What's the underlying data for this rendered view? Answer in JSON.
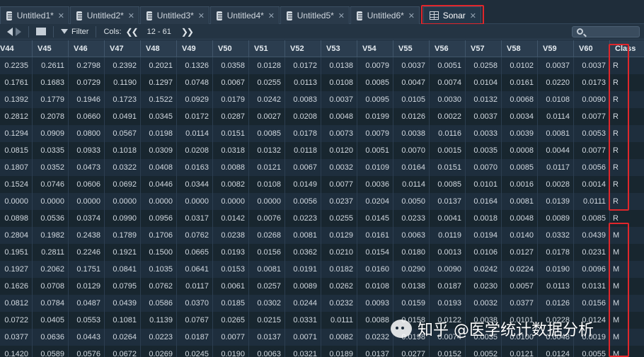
{
  "tabs": [
    {
      "label": "Untitled1*"
    },
    {
      "label": "Untitled2*"
    },
    {
      "label": "Untitled3*"
    },
    {
      "label": "Untitled4*"
    },
    {
      "label": "Untitled5*"
    },
    {
      "label": "Untitled6*"
    },
    {
      "label": "Sonar",
      "active": true
    }
  ],
  "toolbar": {
    "filter_label": "Filter",
    "cols_label": "Cols:",
    "cols_range": "12 - 61"
  },
  "table": {
    "columns": [
      "V44",
      "V45",
      "V46",
      "V47",
      "V48",
      "V49",
      "V50",
      "V51",
      "V52",
      "V53",
      "V54",
      "V55",
      "V56",
      "V57",
      "V58",
      "V59",
      "V60",
      "Class"
    ],
    "rows": [
      [
        "0.2235",
        "0.2611",
        "0.2798",
        "0.2392",
        "0.2021",
        "0.1326",
        "0.0358",
        "0.0128",
        "0.0172",
        "0.0138",
        "0.0079",
        "0.0037",
        "0.0051",
        "0.0258",
        "0.0102",
        "0.0037",
        "0.0037",
        "R"
      ],
      [
        "0.1761",
        "0.1683",
        "0.0729",
        "0.1190",
        "0.1297",
        "0.0748",
        "0.0067",
        "0.0255",
        "0.0113",
        "0.0108",
        "0.0085",
        "0.0047",
        "0.0074",
        "0.0104",
        "0.0161",
        "0.0220",
        "0.0173",
        "R"
      ],
      [
        "0.1392",
        "0.1779",
        "0.1946",
        "0.1723",
        "0.1522",
        "0.0929",
        "0.0179",
        "0.0242",
        "0.0083",
        "0.0037",
        "0.0095",
        "0.0105",
        "0.0030",
        "0.0132",
        "0.0068",
        "0.0108",
        "0.0090",
        "R"
      ],
      [
        "0.2812",
        "0.2078",
        "0.0660",
        "0.0491",
        "0.0345",
        "0.0172",
        "0.0287",
        "0.0027",
        "0.0208",
        "0.0048",
        "0.0199",
        "0.0126",
        "0.0022",
        "0.0037",
        "0.0034",
        "0.0114",
        "0.0077",
        "R"
      ],
      [
        "0.1294",
        "0.0909",
        "0.0800",
        "0.0567",
        "0.0198",
        "0.0114",
        "0.0151",
        "0.0085",
        "0.0178",
        "0.0073",
        "0.0079",
        "0.0038",
        "0.0116",
        "0.0033",
        "0.0039",
        "0.0081",
        "0.0053",
        "R"
      ],
      [
        "0.0815",
        "0.0335",
        "0.0933",
        "0.1018",
        "0.0309",
        "0.0208",
        "0.0318",
        "0.0132",
        "0.0118",
        "0.0120",
        "0.0051",
        "0.0070",
        "0.0015",
        "0.0035",
        "0.0008",
        "0.0044",
        "0.0077",
        "R"
      ],
      [
        "0.1807",
        "0.0352",
        "0.0473",
        "0.0322",
        "0.0408",
        "0.0163",
        "0.0088",
        "0.0121",
        "0.0067",
        "0.0032",
        "0.0109",
        "0.0164",
        "0.0151",
        "0.0070",
        "0.0085",
        "0.0117",
        "0.0056",
        "R"
      ],
      [
        "0.1524",
        "0.0746",
        "0.0606",
        "0.0692",
        "0.0446",
        "0.0344",
        "0.0082",
        "0.0108",
        "0.0149",
        "0.0077",
        "0.0036",
        "0.0114",
        "0.0085",
        "0.0101",
        "0.0016",
        "0.0028",
        "0.0014",
        "R"
      ],
      [
        "0.0000",
        "0.0000",
        "0.0000",
        "0.0000",
        "0.0000",
        "0.0000",
        "0.0000",
        "0.0000",
        "0.0056",
        "0.0237",
        "0.0204",
        "0.0050",
        "0.0137",
        "0.0164",
        "0.0081",
        "0.0139",
        "0.0111",
        "R"
      ],
      [
        "0.0898",
        "0.0536",
        "0.0374",
        "0.0990",
        "0.0956",
        "0.0317",
        "0.0142",
        "0.0076",
        "0.0223",
        "0.0255",
        "0.0145",
        "0.0233",
        "0.0041",
        "0.0018",
        "0.0048",
        "0.0089",
        "0.0085",
        "R"
      ],
      [
        "0.2804",
        "0.1982",
        "0.2438",
        "0.1789",
        "0.1706",
        "0.0762",
        "0.0238",
        "0.0268",
        "0.0081",
        "0.0129",
        "0.0161",
        "0.0063",
        "0.0119",
        "0.0194",
        "0.0140",
        "0.0332",
        "0.0439",
        "M"
      ],
      [
        "0.1951",
        "0.2811",
        "0.2246",
        "0.1921",
        "0.1500",
        "0.0665",
        "0.0193",
        "0.0156",
        "0.0362",
        "0.0210",
        "0.0154",
        "0.0180",
        "0.0013",
        "0.0106",
        "0.0127",
        "0.0178",
        "0.0231",
        "M"
      ],
      [
        "0.1927",
        "0.2062",
        "0.1751",
        "0.0841",
        "0.1035",
        "0.0641",
        "0.0153",
        "0.0081",
        "0.0191",
        "0.0182",
        "0.0160",
        "0.0290",
        "0.0090",
        "0.0242",
        "0.0224",
        "0.0190",
        "0.0096",
        "M"
      ],
      [
        "0.1626",
        "0.0708",
        "0.0129",
        "0.0795",
        "0.0762",
        "0.0117",
        "0.0061",
        "0.0257",
        "0.0089",
        "0.0262",
        "0.0108",
        "0.0138",
        "0.0187",
        "0.0230",
        "0.0057",
        "0.0113",
        "0.0131",
        "M"
      ],
      [
        "0.0812",
        "0.0784",
        "0.0487",
        "0.0439",
        "0.0586",
        "0.0370",
        "0.0185",
        "0.0302",
        "0.0244",
        "0.0232",
        "0.0093",
        "0.0159",
        "0.0193",
        "0.0032",
        "0.0377",
        "0.0126",
        "0.0156",
        "M"
      ],
      [
        "0.0722",
        "0.0405",
        "0.0553",
        "0.1081",
        "0.1139",
        "0.0767",
        "0.0265",
        "0.0215",
        "0.0331",
        "0.0111",
        "0.0088",
        "0.0158",
        "0.0122",
        "0.0038",
        "0.0101",
        "0.0228",
        "0.0124",
        "M"
      ],
      [
        "0.0377",
        "0.0636",
        "0.0443",
        "0.0264",
        "0.0223",
        "0.0187",
        "0.0077",
        "0.0137",
        "0.0071",
        "0.0082",
        "0.0232",
        "0.0198",
        "0.0074",
        "0.0035",
        "0.0100",
        "0.0048",
        "0.0019",
        "M"
      ],
      [
        "0.1420",
        "0.0589",
        "0.0576",
        "0.0672",
        "0.0269",
        "0.0245",
        "0.0190",
        "0.0063",
        "0.0321",
        "0.0189",
        "0.0137",
        "0.0277",
        "0.0152",
        "0.0052",
        "0.0121",
        "0.0124",
        "0.0055",
        "M"
      ]
    ]
  },
  "watermark": {
    "text": "知乎 @医学统计数据分析"
  },
  "colors": {
    "highlight": "#e0262b",
    "background": "#1b2a38",
    "header": "#2b3d4f"
  },
  "icons": [
    "back-arrow-icon",
    "forward-arrow-icon",
    "popout-icon",
    "filter-icon",
    "prev-cols-icon",
    "next-cols-icon",
    "search-icon",
    "file-icon",
    "grid-icon",
    "close-icon"
  ]
}
